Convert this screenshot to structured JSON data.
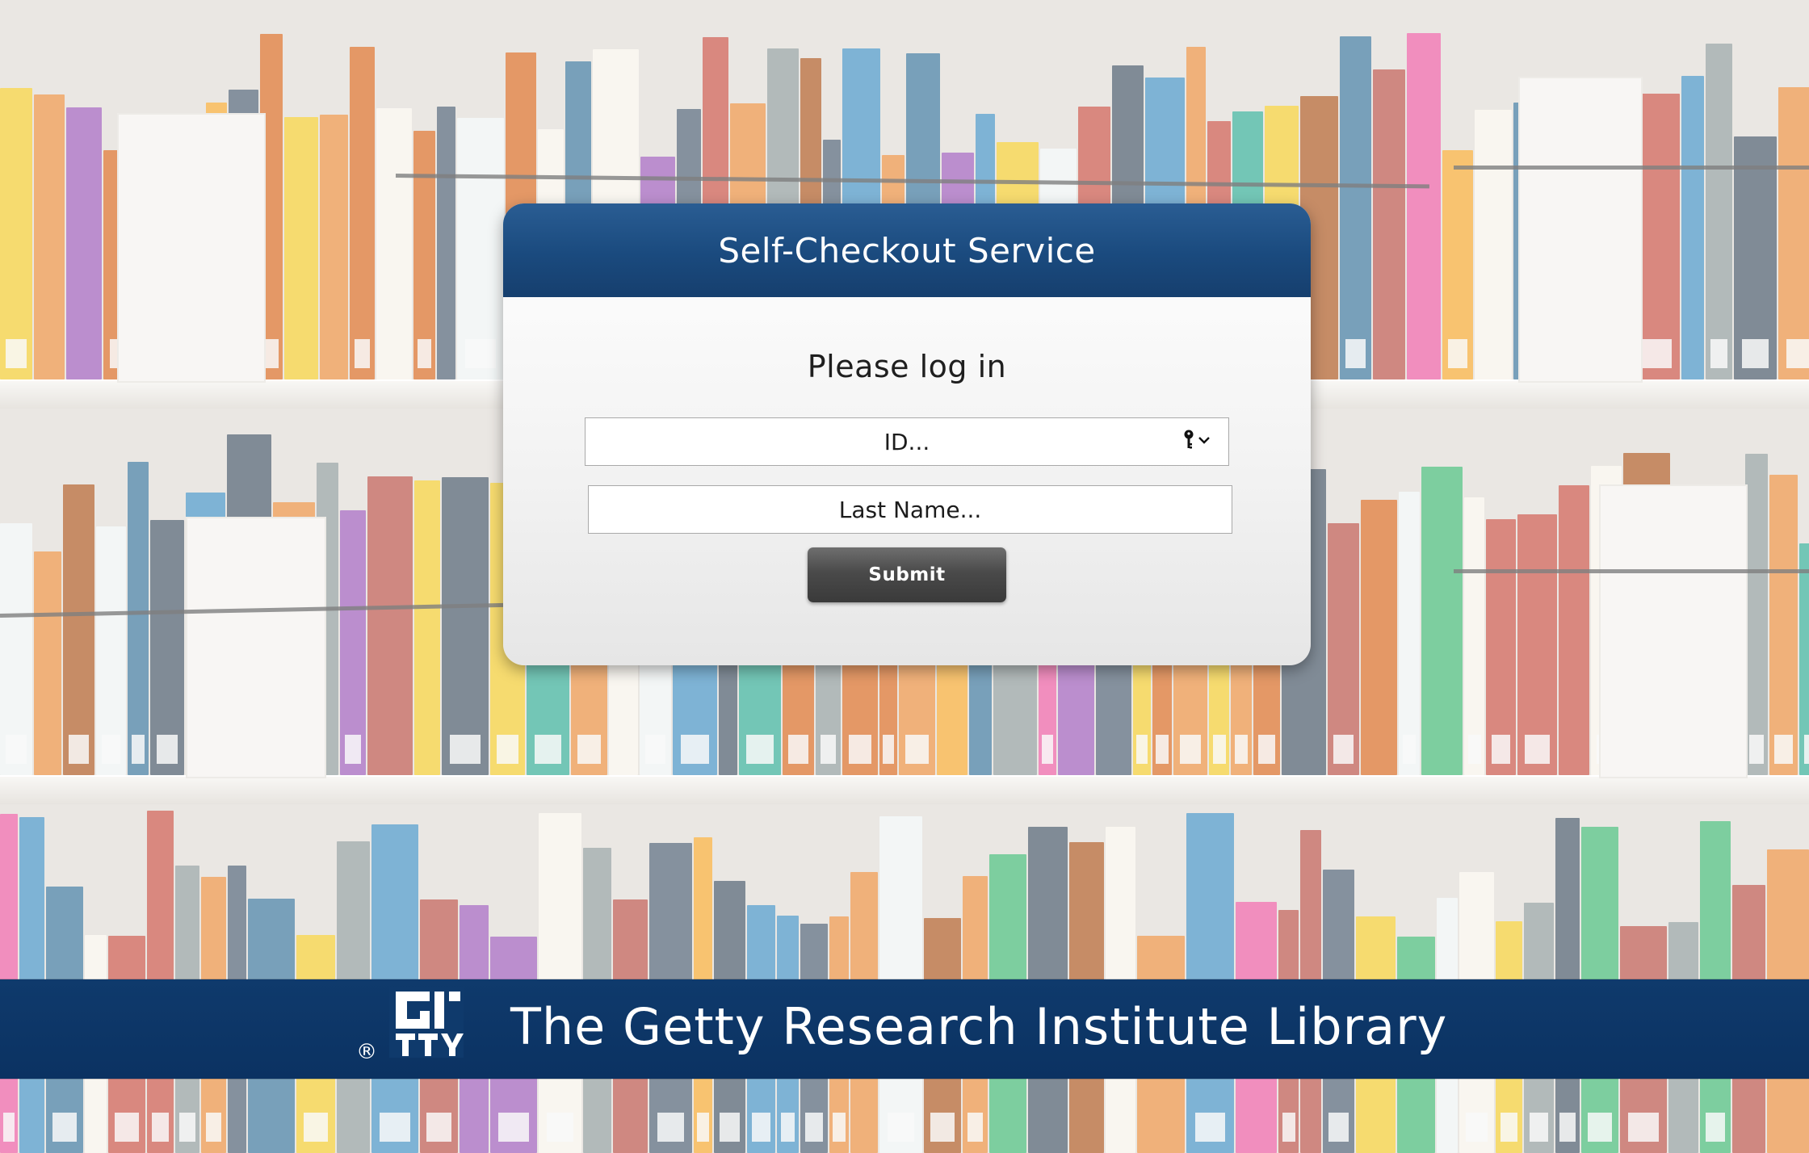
{
  "login": {
    "title": "Self-Checkout Service",
    "heading": "Please log in",
    "id_placeholder": "ID...",
    "last_name_placeholder": "Last Name...",
    "submit_label": "Submit"
  },
  "footer": {
    "library_name": "The Getty Research Institute Library",
    "registered_mark": "®",
    "logo_icon": "getty-logo-icon"
  },
  "icons": {
    "id_field": [
      "key-icon",
      "chevron-down-icon"
    ]
  },
  "colors": {
    "header_blue": "#1a4a7e",
    "footer_blue": "#0f3a6c",
    "button_gray": "#4a4a4a"
  }
}
